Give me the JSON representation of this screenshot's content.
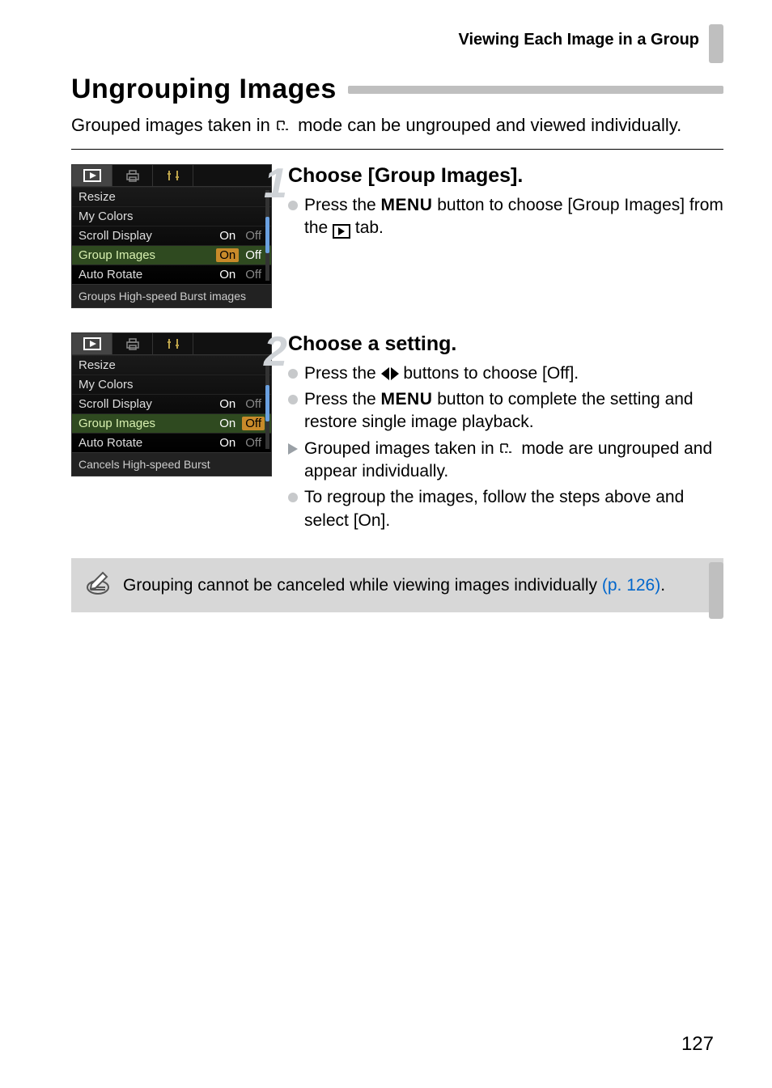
{
  "header": {
    "section": "Viewing Each Image in a Group"
  },
  "title": "Ungrouping Images",
  "intro": {
    "part1": "Grouped images taken in ",
    "part2": " mode can be ungrouped and viewed individually."
  },
  "steps": [
    {
      "num": "1",
      "title": "Choose [Group Images].",
      "bullets": [
        {
          "kind": "dot",
          "segments": [
            "Press the ",
            "MENU",
            " button to choose [Group Images] from the ",
            "PLAYTAB",
            " tab."
          ]
        }
      ],
      "lcd": {
        "rows": [
          {
            "label": "Resize",
            "values": []
          },
          {
            "label": "My Colors",
            "values": []
          },
          {
            "label": "Scroll Display",
            "values": [
              {
                "t": "On",
                "style": "on"
              },
              {
                "t": "Off",
                "style": "dim"
              }
            ]
          },
          {
            "label": "Group Images",
            "highlight": true,
            "values": [
              {
                "t": "On",
                "style": "box"
              },
              {
                "t": "Off",
                "style": "on"
              }
            ]
          },
          {
            "label": "Auto Rotate",
            "values": [
              {
                "t": "On",
                "style": "on"
              },
              {
                "t": "Off",
                "style": "dim"
              }
            ]
          }
        ],
        "footer": "Groups High-speed Burst images"
      }
    },
    {
      "num": "2",
      "title": "Choose a setting.",
      "bullets": [
        {
          "kind": "dot",
          "segments": [
            "Press the ",
            "ARROWS",
            " buttons to choose [Off]."
          ]
        },
        {
          "kind": "dot",
          "segments": [
            "Press the ",
            "MENU",
            " button to complete the setting and restore single image playback."
          ]
        },
        {
          "kind": "tri",
          "segments": [
            "Grouped images taken in ",
            "BURST",
            " mode are ungrouped and appear individually."
          ]
        },
        {
          "kind": "dot",
          "segments": [
            "To regroup the images, follow the steps above and select [On]."
          ]
        }
      ],
      "lcd": {
        "rows": [
          {
            "label": "Resize",
            "values": []
          },
          {
            "label": "My Colors",
            "values": []
          },
          {
            "label": "Scroll Display",
            "values": [
              {
                "t": "On",
                "style": "on"
              },
              {
                "t": "Off",
                "style": "dim"
              }
            ]
          },
          {
            "label": "Group Images",
            "highlight": true,
            "values": [
              {
                "t": "On",
                "style": "on"
              },
              {
                "t": "Off",
                "style": "box"
              }
            ]
          },
          {
            "label": "Auto Rotate",
            "values": [
              {
                "t": "On",
                "style": "on"
              },
              {
                "t": "Off",
                "style": "dim"
              }
            ]
          }
        ],
        "footer": "Cancels High-speed Burst"
      }
    }
  ],
  "note": {
    "text": "Grouping cannot be canceled while viewing images individually ",
    "link": "(p. 126)",
    "tail": "."
  },
  "page_number": "127"
}
